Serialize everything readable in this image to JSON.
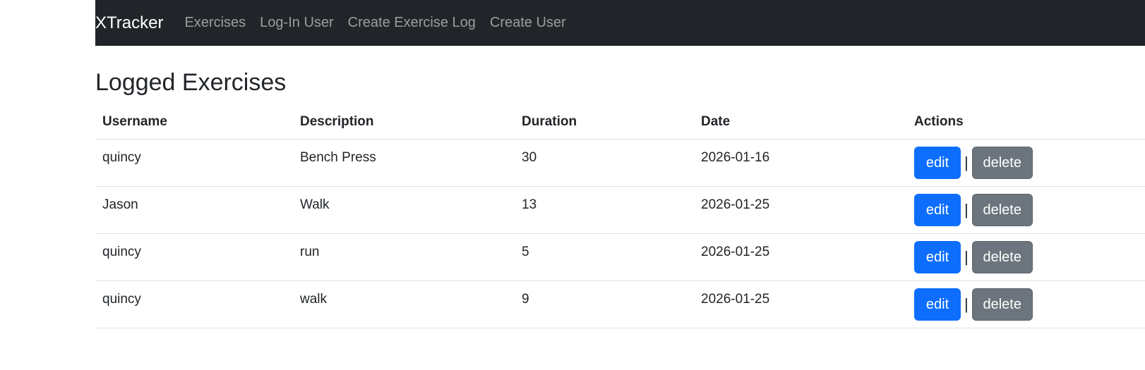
{
  "navbar": {
    "brand": "XTracker",
    "links": [
      "Exercises",
      "Log-In User",
      "Create Exercise Log",
      "Create User"
    ]
  },
  "page": {
    "title": "Logged Exercises"
  },
  "table": {
    "headers": [
      "Username",
      "Description",
      "Duration",
      "Date",
      "Actions"
    ],
    "rows": [
      {
        "username": "quincy",
        "description": "Bench Press",
        "duration": "30",
        "date": "2026-01-16"
      },
      {
        "username": "Jason",
        "description": "Walk",
        "duration": "13",
        "date": "2026-01-25"
      },
      {
        "username": "quincy",
        "description": "run",
        "duration": "5",
        "date": "2026-01-25"
      },
      {
        "username": "quincy",
        "description": "walk",
        "duration": "9",
        "date": "2026-01-25"
      }
    ],
    "edit_label": "edit",
    "delete_label": "delete",
    "separator": "|"
  },
  "colors": {
    "navbar_bg": "#212529",
    "edit_button": "#0d6efd",
    "delete_button": "#6c757d"
  }
}
